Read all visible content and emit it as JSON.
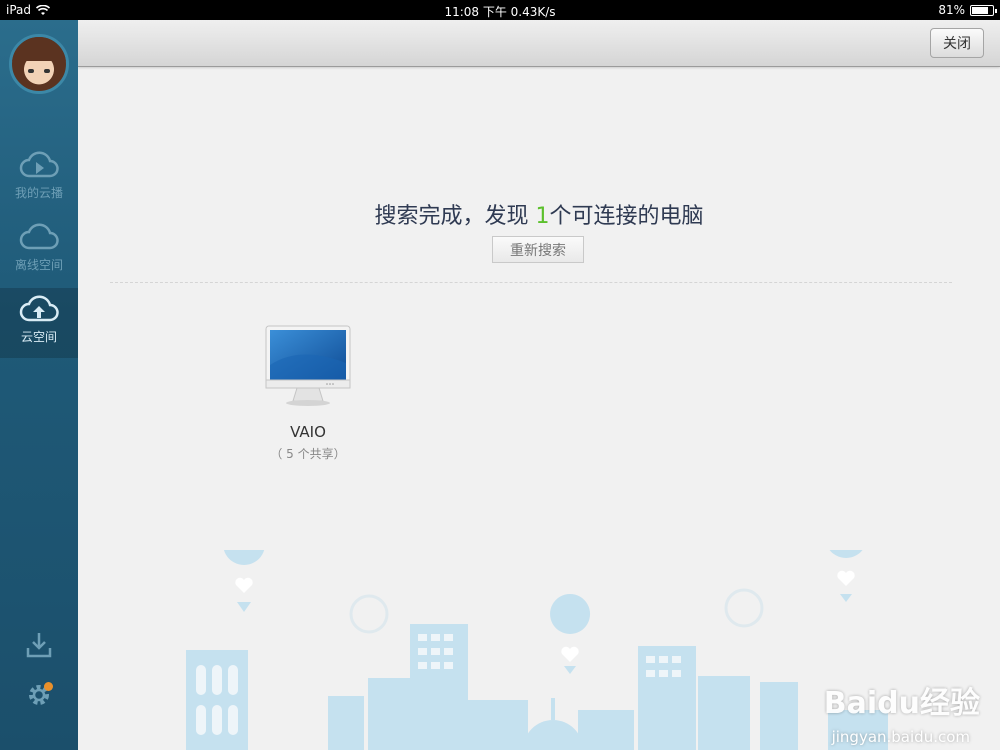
{
  "status_bar": {
    "device": "iPad",
    "time": "11:08 下午 0.43K/s",
    "battery": "81%",
    "battery_level": 0.81
  },
  "sidebar": {
    "items": [
      {
        "label": "我的云播",
        "icon": "play-cloud-icon"
      },
      {
        "label": "离线空间",
        "icon": "cloud-icon"
      },
      {
        "label": "云空间",
        "icon": "cloud-upload-icon"
      }
    ],
    "download_icon": "download-icon",
    "settings_icon": "gear-icon",
    "settings_badge_color": "#e8902b"
  },
  "topbar": {
    "close_label": "关闭"
  },
  "result": {
    "prefix": "搜索完成，发现",
    "count": "1",
    "suffix": "个可连接的电脑",
    "count_color": "#5cc02c",
    "research_label": "重新搜索"
  },
  "devices": [
    {
      "name": "VAIO",
      "shares": "（ 5 个共享）",
      "icon": "monitor-icon"
    }
  ],
  "watermark": {
    "text": "Baidu经验",
    "url": "jingyan.baidu.com"
  }
}
